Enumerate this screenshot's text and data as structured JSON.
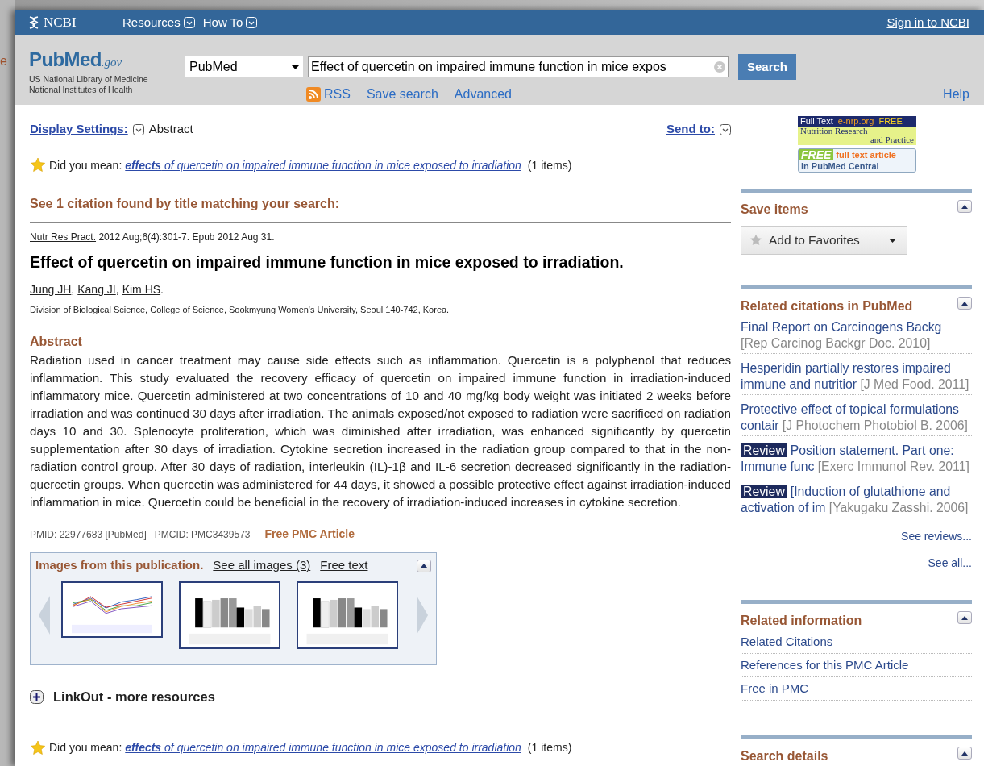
{
  "background_fragment": "e",
  "header": {
    "logo": "NCBI",
    "menus": [
      {
        "label": "Resources"
      },
      {
        "label": "How To"
      }
    ],
    "sign_in": "Sign in to NCBI"
  },
  "masthead": {
    "logo_name": "PubMed",
    "logo_suffix": ".gov",
    "logo_lines": [
      "US National Library of Medicine",
      "National Institutes of Health"
    ],
    "database": "PubMed",
    "query": "Effect of quercetin on impaired immune function in mice expos",
    "search_button": "Search",
    "links": [
      {
        "label": "RSS",
        "kind": "rss"
      },
      {
        "label": "Save search",
        "kind": "plain"
      },
      {
        "label": "Advanced",
        "kind": "plain"
      }
    ],
    "help": "Help"
  },
  "main": {
    "display_settings": "Display Settings:",
    "format": "Abstract",
    "send_to": "Send to:",
    "did_you_mean": [
      {
        "prompt": "Did you mean:",
        "suggestion": "**effects** of quercetin on impaired immune function in mice exposed to irradiation",
        "count": "(1 items)"
      },
      {
        "prompt": "Did you mean:",
        "suggestion": "**effects** of quercetin on impaired immune function in mice exposed to irradiation",
        "count": "(1 items)"
      }
    ],
    "citation_heading": "See 1 citation found by title matching your search:",
    "journal": "Nutr Res Pract.",
    "citation_info": "2012 Aug;6(4):301-7. Epub 2012 Aug 31.",
    "title": "Effect of quercetin on impaired immune function in mice exposed to irradiation.",
    "authors": [
      {
        "name": "Jung JH",
        "after": ","
      },
      {
        "name": "Kang JI",
        "after": ","
      },
      {
        "name": "Kim HS",
        "after": "."
      }
    ],
    "affiliation": "Division of Biological Science, College of Science, Sookmyung Women's University, Seoul 140-742, Korea.",
    "abstract_heading": "Abstract",
    "abstract": "Radiation used in cancer treatment may cause side effects such as inflammation. Quercetin is a polyphenol that reduces inflammation. This study evaluated the recovery efficacy of quercetin on impaired immune function in irradiation-induced inflammatory mice. Quercetin administered at two concentrations of 10 and 40 mg/kg body weight was initiated 2 weeks before irradiation and was continued 30 days after irradiation. The animals exposed/not exposed to radiation were sacrificed on radiation days 10 and 30. Splenocyte proliferation, which was diminished after irradiation, was enhanced significantly by quercetin supplementation after 30 days of irradiation. Cytokine secretion increased in the radiation group compared to that in the non-radiation control group. After 30 days of radiation, interleukin (IL)-1β and IL-6 secretion decreased significantly in the radiation-quercetin groups. When quercetin was administered for 44 days, it showed a possible protective effect against irradiation-induced inflammation in mice. Quercetin could be beneficial in the recovery of irradiation-induced increases in cytokine secretion.",
    "pmid": "PMID: 22977683 [PubMed]",
    "pmcid": "PMCID: PMC3439573",
    "free_article": "Free PMC Article",
    "images": {
      "title": "Images from this publication.",
      "see_all": "See all images (3)",
      "free_text": "Free text",
      "thumbnails": [
        {
          "kind": "line"
        },
        {
          "kind": "bar"
        },
        {
          "kind": "bar"
        }
      ]
    },
    "linkout": "LinkOut - more resources"
  },
  "sidebar": {
    "journal_banner": {
      "top": [
        "Full Text",
        "e-nrp.org",
        "FREE"
      ],
      "name_lines": [
        "Nutrition Research",
        "and Practice"
      ]
    },
    "pmc_badge": {
      "free": "FREE",
      "text": "full text article",
      "line2": "in PubMed Central"
    },
    "save_items": {
      "title": "Save items",
      "button": "Add to Favorites"
    },
    "related_citations": {
      "title": "Related citations in PubMed",
      "items": [
        {
          "review": false,
          "title": "Final Report on Carcinogens Backg",
          "source": "[Rep Carcinog Backgr Doc. 2010]"
        },
        {
          "review": false,
          "title": "Hesperidin partially restores impaired immune and nutritior",
          "source": "[J Med Food. 2011]"
        },
        {
          "review": false,
          "title": "Protective effect of topical formulations contair",
          "source": "[J Photochem Photobiol B. 2006]"
        },
        {
          "review": true,
          "badge": "Review",
          "title": "Position statement. Part one: Immune func",
          "source": "[Exerc Immunol Rev. 2011]"
        },
        {
          "review": true,
          "badge": "Review",
          "title": "[Induction of glutathione and activation of im",
          "source": "[Yakugaku Zasshi. 2006]"
        }
      ],
      "see_reviews": "See reviews...",
      "see_all": "See all..."
    },
    "related_information": {
      "title": "Related information",
      "items": [
        "Related Citations",
        "References for this PMC Article",
        "Free in PMC"
      ]
    },
    "search_details": {
      "title": "Search details"
    }
  }
}
